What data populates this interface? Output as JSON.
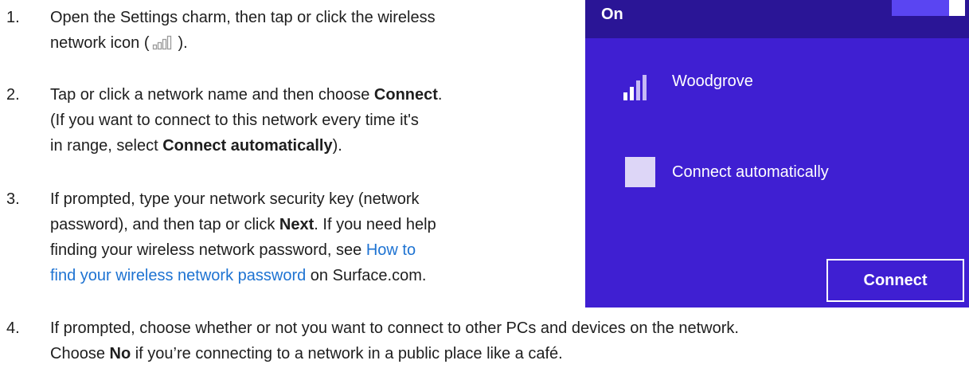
{
  "steps": [
    {
      "number": "1.",
      "lines": [
        {
          "pre": "Open the Settings charm, then tap or click the wireless"
        },
        {
          "pre": "network icon (",
          "post": ")."
        }
      ]
    },
    {
      "number": "2.",
      "lines": [
        {
          "pre": "Tap or click a network name and then choose ",
          "bold": "Connect",
          "post": "."
        },
        {
          "pre": "(If you want to connect to this network every time it's"
        },
        {
          "pre": "in range, select ",
          "bold": "Connect automatically",
          "post": ")."
        }
      ]
    },
    {
      "number": "3.",
      "lines": [
        {
          "pre": "If prompted, type your network security key (network"
        },
        {
          "pre": "password), and then tap or click ",
          "bold": "Next",
          "post": ". If you need help"
        },
        {
          "pre": "finding your wireless network password, see ",
          "link": "How to"
        },
        {
          "link": "find your wireless network password",
          "post": " on Surface.com."
        }
      ]
    },
    {
      "number": "4.",
      "lines": [
        {
          "pre": "If prompted, choose whether or not you want to connect to other PCs and devices on the network."
        },
        {
          "pre": "Choose ",
          "bold": "No",
          "post": " if you’re connecting to a network in a public place like a café."
        }
      ]
    }
  ],
  "panel": {
    "toggle_label": "On",
    "network_name": "Woodgrove",
    "checkbox_label": "Connect automatically",
    "checkbox_checked": false,
    "connect_button": "Connect",
    "colors": {
      "background": "#3f1fd2",
      "header": "#2a1596",
      "toggle": "#5a45f2",
      "text": "#ffffff"
    },
    "network_icon": "wifi-signal-icon"
  },
  "colors": {
    "text": "#1e1e1e",
    "link": "#1e73d2"
  }
}
